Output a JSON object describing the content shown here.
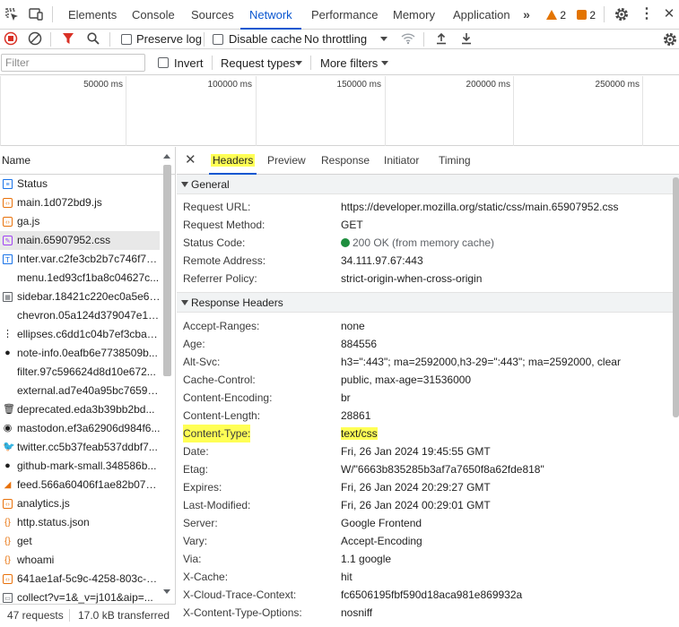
{
  "topbar": {
    "tabs": [
      "Elements",
      "Console",
      "Sources",
      "Network",
      "Performance",
      "Memory",
      "Application"
    ],
    "active_tab": "Network",
    "warnings_count": "2",
    "errors_count": "2"
  },
  "toolbar": {
    "preserve_log": "Preserve log",
    "disable_cache": "Disable cache",
    "throttling": "No throttling"
  },
  "filterbar": {
    "placeholder": "Filter",
    "invert": "Invert",
    "request_types": "Request types",
    "more_filters": "More filters"
  },
  "overview": {
    "ticks": [
      "50000 ms",
      "100000 ms",
      "150000 ms",
      "200000 ms",
      "250000 ms"
    ]
  },
  "request_list": {
    "header": "Name",
    "rows": [
      {
        "name": "Status",
        "icon": "doc"
      },
      {
        "name": "main.1d072bd9.js",
        "icon": "js"
      },
      {
        "name": "ga.js",
        "icon": "js"
      },
      {
        "name": "main.65907952.css",
        "icon": "css",
        "selected": true
      },
      {
        "name": "Inter.var.c2fe3cb2b7c746f79...",
        "icon": "font"
      },
      {
        "name": "menu.1ed93cf1ba8c04627c...",
        "icon": "none"
      },
      {
        "name": "sidebar.18421c220ec0a5e69...",
        "icon": "img"
      },
      {
        "name": "chevron.05a124d379047e16...",
        "icon": "none"
      },
      {
        "name": "ellipses.c6dd1c04b7ef3cba1...",
        "icon": "ellipsis"
      },
      {
        "name": "note-info.0eafb6e7738509b...",
        "icon": "info"
      },
      {
        "name": "filter.97c596624d8d10e672...",
        "icon": "none"
      },
      {
        "name": "external.ad7e40a95bc76596...",
        "icon": "none"
      },
      {
        "name": "deprecated.eda3b39bb2bd...",
        "icon": "trash"
      },
      {
        "name": "mastodon.ef3a62906d984f6...",
        "icon": "mastodon"
      },
      {
        "name": "twitter.cc5b37feab537ddbf7...",
        "icon": "twitter"
      },
      {
        "name": "github-mark-small.348586b...",
        "icon": "github"
      },
      {
        "name": "feed.566a60406f1ae82b073...",
        "icon": "rss"
      },
      {
        "name": "analytics.js",
        "icon": "js"
      },
      {
        "name": "http.status.json",
        "icon": "json"
      },
      {
        "name": "get",
        "icon": "json"
      },
      {
        "name": "whoami",
        "icon": "json"
      },
      {
        "name": "641ae1af-5c9c-4258-803c-6...",
        "icon": "js"
      },
      {
        "name": "collect?v=1&_v=j101&aip=...",
        "icon": "gen"
      }
    ],
    "status_requests": "47 requests",
    "status_transferred": "17.0 kB transferred"
  },
  "details": {
    "tabs": [
      "Headers",
      "Preview",
      "Response",
      "Initiator",
      "Timing"
    ],
    "active_tab": "Headers",
    "general_title": "General",
    "general": [
      {
        "k": "Request URL:",
        "v": "https://developer.mozilla.org/static/css/main.65907952.css"
      },
      {
        "k": "Request Method:",
        "v": "GET"
      },
      {
        "k": "Status Code:",
        "v": "200 OK (from memory cache)",
        "status": true
      },
      {
        "k": "Remote Address:",
        "v": "34.111.97.67:443"
      },
      {
        "k": "Referrer Policy:",
        "v": "strict-origin-when-cross-origin"
      }
    ],
    "response_title": "Response Headers",
    "response": [
      {
        "k": "Accept-Ranges:",
        "v": "none"
      },
      {
        "k": "Age:",
        "v": "884556"
      },
      {
        "k": "Alt-Svc:",
        "v": "h3=\":443\"; ma=2592000,h3-29=\":443\"; ma=2592000, clear"
      },
      {
        "k": "Cache-Control:",
        "v": "public, max-age=31536000"
      },
      {
        "k": "Content-Encoding:",
        "v": "br"
      },
      {
        "k": "Content-Length:",
        "v": "28861"
      },
      {
        "k": "Content-Type:",
        "v": "text/css",
        "highlight": true
      },
      {
        "k": "Date:",
        "v": "Fri, 26 Jan 2024 19:45:55 GMT"
      },
      {
        "k": "Etag:",
        "v": "W/\"6663b835285b3af7a7650f8a62fde818\""
      },
      {
        "k": "Expires:",
        "v": "Fri, 26 Jan 2024 20:29:27 GMT"
      },
      {
        "k": "Last-Modified:",
        "v": "Fri, 26 Jan 2024 00:29:01 GMT"
      },
      {
        "k": "Server:",
        "v": "Google Frontend"
      },
      {
        "k": "Vary:",
        "v": "Accept-Encoding"
      },
      {
        "k": "Via:",
        "v": "1.1 google"
      },
      {
        "k": "X-Cache:",
        "v": "hit"
      },
      {
        "k": "X-Cloud-Trace-Context:",
        "v": "fc6506195fbf590d18aca981e869932a"
      },
      {
        "k": "X-Content-Type-Options:",
        "v": "nosniff"
      }
    ]
  },
  "colors": {
    "accent": "#0b57d0",
    "warning": "#e37400",
    "status_ok": "#1e8e3e",
    "highlight": "#ffff55"
  }
}
